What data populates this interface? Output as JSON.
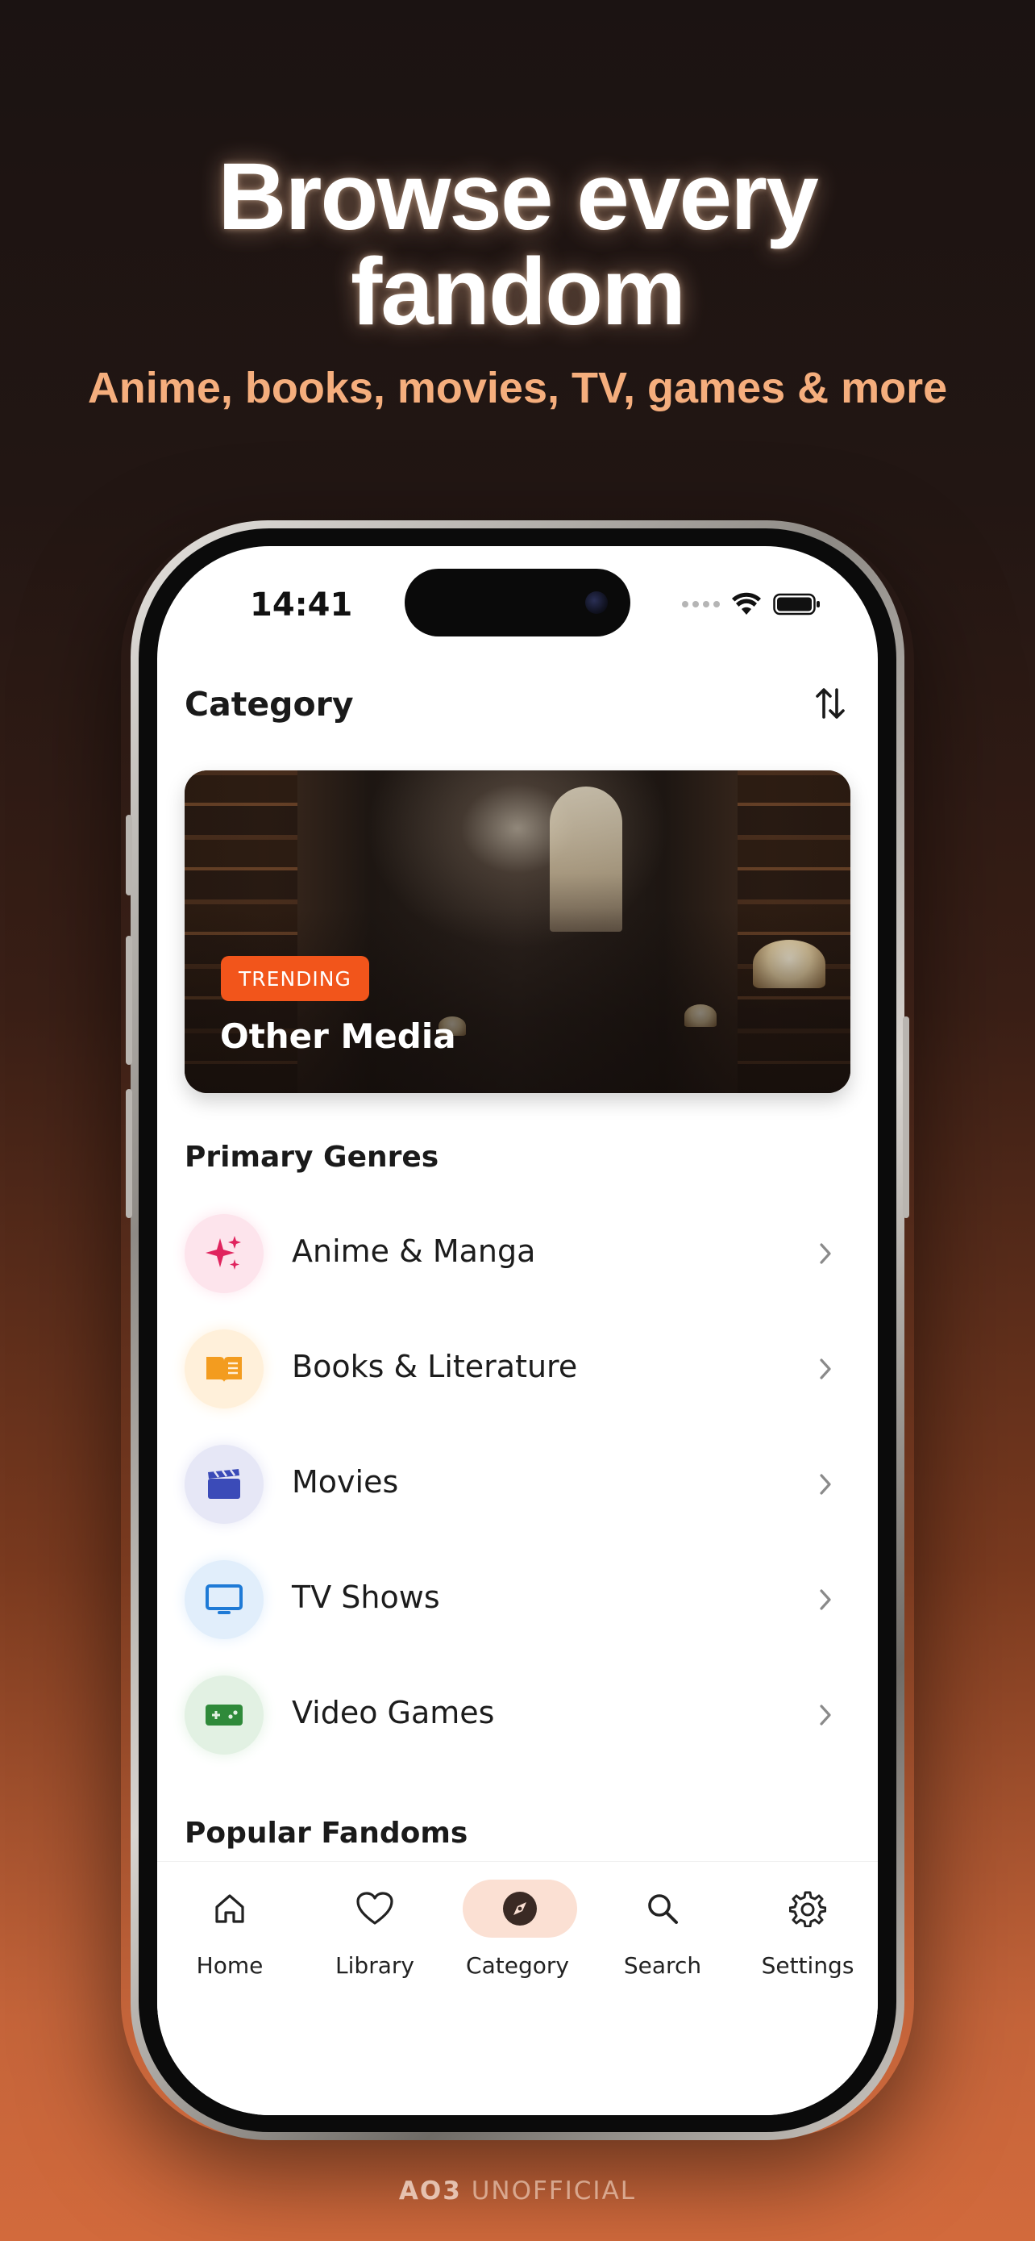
{
  "hero": {
    "title_line1": "Browse every",
    "title_line2": "fandom",
    "subtitle": "Anime, books, movies, TV, games & more"
  },
  "status_bar": {
    "time": "14:41",
    "icons": [
      "signal-dots-icon",
      "wifi-icon",
      "battery-icon"
    ]
  },
  "header": {
    "title": "Category",
    "sort_icon": "sort-arrows-icon"
  },
  "trending_card": {
    "badge": "TRENDING",
    "title": "Other Media"
  },
  "primary_genres": {
    "section_title": "Primary Genres",
    "items": [
      {
        "label": "Anime & Manga",
        "icon": "sparkles-icon",
        "bg": "#fde4ec",
        "color": "#e0245e"
      },
      {
        "label": "Books & Literature",
        "icon": "book-icon",
        "bg": "#fff0da",
        "color": "#f39c1f"
      },
      {
        "label": "Movies",
        "icon": "clapperboard-icon",
        "bg": "#e6e7f6",
        "color": "#3b4bb8"
      },
      {
        "label": "TV Shows",
        "icon": "tv-icon",
        "bg": "#e1eefb",
        "color": "#1e7ad6"
      },
      {
        "label": "Video Games",
        "icon": "gamepad-icon",
        "bg": "#e2f1e3",
        "color": "#2f8a3a"
      }
    ]
  },
  "popular_fandoms": {
    "section_title": "Popular Fandoms"
  },
  "tabbar": {
    "tabs": [
      {
        "label": "Home",
        "icon": "home-icon"
      },
      {
        "label": "Library",
        "icon": "heart-icon"
      },
      {
        "label": "Category",
        "icon": "compass-icon",
        "active": true
      },
      {
        "label": "Search",
        "icon": "search-icon"
      },
      {
        "label": "Settings",
        "icon": "gear-icon"
      }
    ]
  },
  "footer": {
    "brand": "AO3",
    "suffix": "UNOFFICIAL"
  },
  "colors": {
    "accent": "#f2551b",
    "subtitle": "#f5ae7d",
    "active_tab_bg": "#fbe0d3"
  }
}
